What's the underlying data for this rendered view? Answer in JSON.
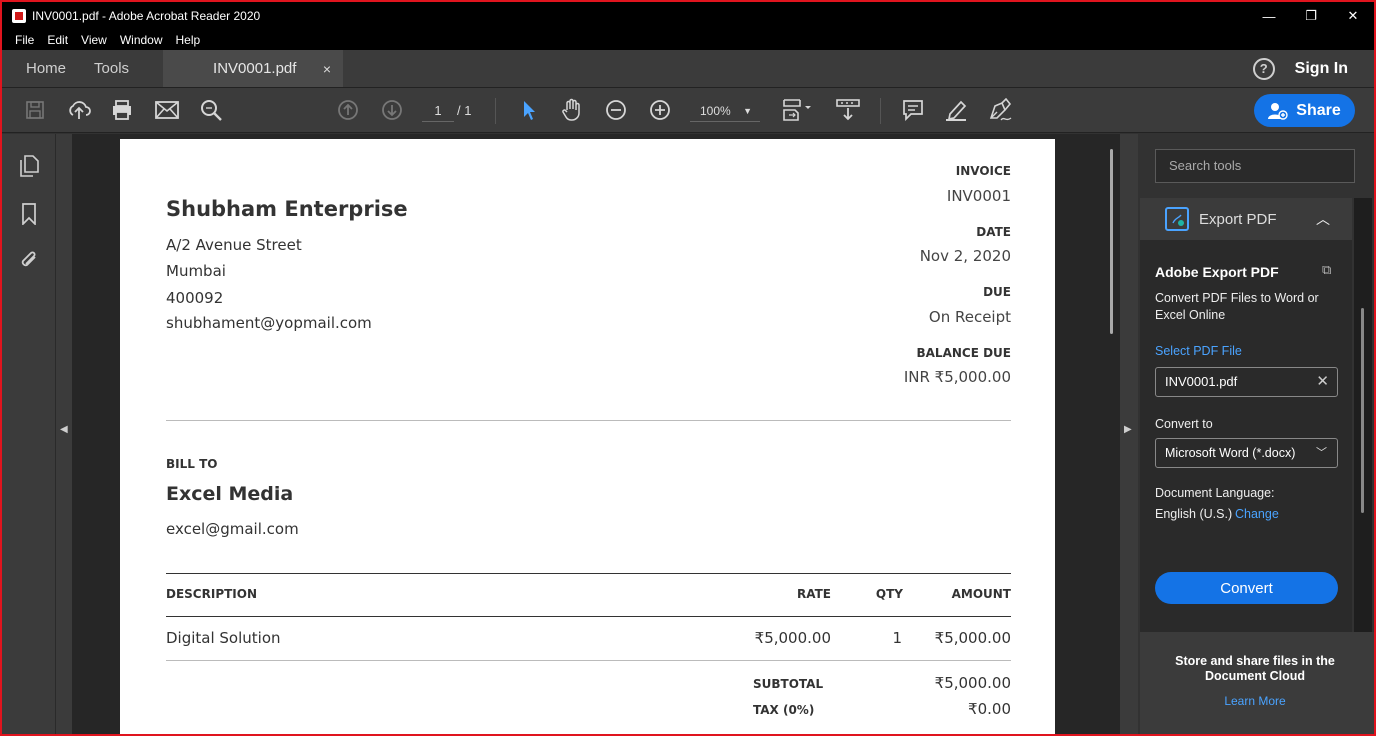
{
  "window": {
    "title": "INV0001.pdf - Adobe Acrobat Reader 2020",
    "minimize": "—",
    "maximize": "❐",
    "close": "✕"
  },
  "menu": {
    "file": "File",
    "edit": "Edit",
    "view": "View",
    "window": "Window",
    "help": "Help"
  },
  "tabs": {
    "home": "Home",
    "tools": "Tools",
    "doc": "INV0001.pdf",
    "close": "×"
  },
  "header": {
    "help_icon": "?",
    "sign_in": "Sign In"
  },
  "toolbar": {
    "page_current": "1",
    "page_total": "/ 1",
    "zoom": "100%",
    "share_label": "Share",
    "icons": [
      "save-icon",
      "upload-icon",
      "print-icon",
      "email-icon",
      "search-icon",
      "prev-page-icon",
      "next-page-icon",
      "select-icon",
      "hand-icon",
      "zoom-out-icon",
      "zoom-in-icon",
      "page-display-icon",
      "scroll-mode-icon",
      "comment-icon",
      "highlight-icon",
      "sign-icon"
    ]
  },
  "invoice": {
    "company": "Shubham Enterprise",
    "address1": "A/2 Avenue Street",
    "address2": "Mumbai",
    "address3": "400092",
    "email": "shubhament@yopmail.com",
    "invoice_label": "INVOICE",
    "invoice_no": "INV0001",
    "date_label": "DATE",
    "date": "Nov 2, 2020",
    "due_label": "DUE",
    "due": "On Receipt",
    "balance_label": "BALANCE DUE",
    "balance": "INR ₹5,000.00",
    "bill_to_label": "BILL TO",
    "client": "Excel Media",
    "client_email": "excel@gmail.com",
    "columns": {
      "description": "DESCRIPTION",
      "rate": "RATE",
      "qty": "QTY",
      "amount": "AMOUNT"
    },
    "items": [
      {
        "description": "Digital Solution",
        "rate": "₹5,000.00",
        "qty": "1",
        "amount": "₹5,000.00"
      }
    ],
    "subtotal_label": "SUBTOTAL",
    "subtotal": "₹5,000.00",
    "tax_label": "TAX (0%)",
    "tax": "₹0.00"
  },
  "panel": {
    "search_placeholder": "Search tools",
    "export_header": "Export PDF",
    "export_title": "Adobe Export PDF",
    "export_desc": "Convert PDF Files to Word or Excel Online",
    "select_file": "Select PDF File",
    "file_name": "INV0001.pdf",
    "convert_to_label": "Convert to",
    "convert_to_value": "Microsoft Word (*.docx)",
    "doc_lang_label": "Document Language:",
    "doc_lang_value": "English (U.S.)",
    "change": "Change",
    "convert_button": "Convert",
    "cloud_text": "Store and share files in the Document Cloud",
    "learn_more": "Learn More"
  },
  "colors": {
    "accent": "#1473e6",
    "link": "#4aa3ff",
    "border_red": "#e0141e"
  }
}
